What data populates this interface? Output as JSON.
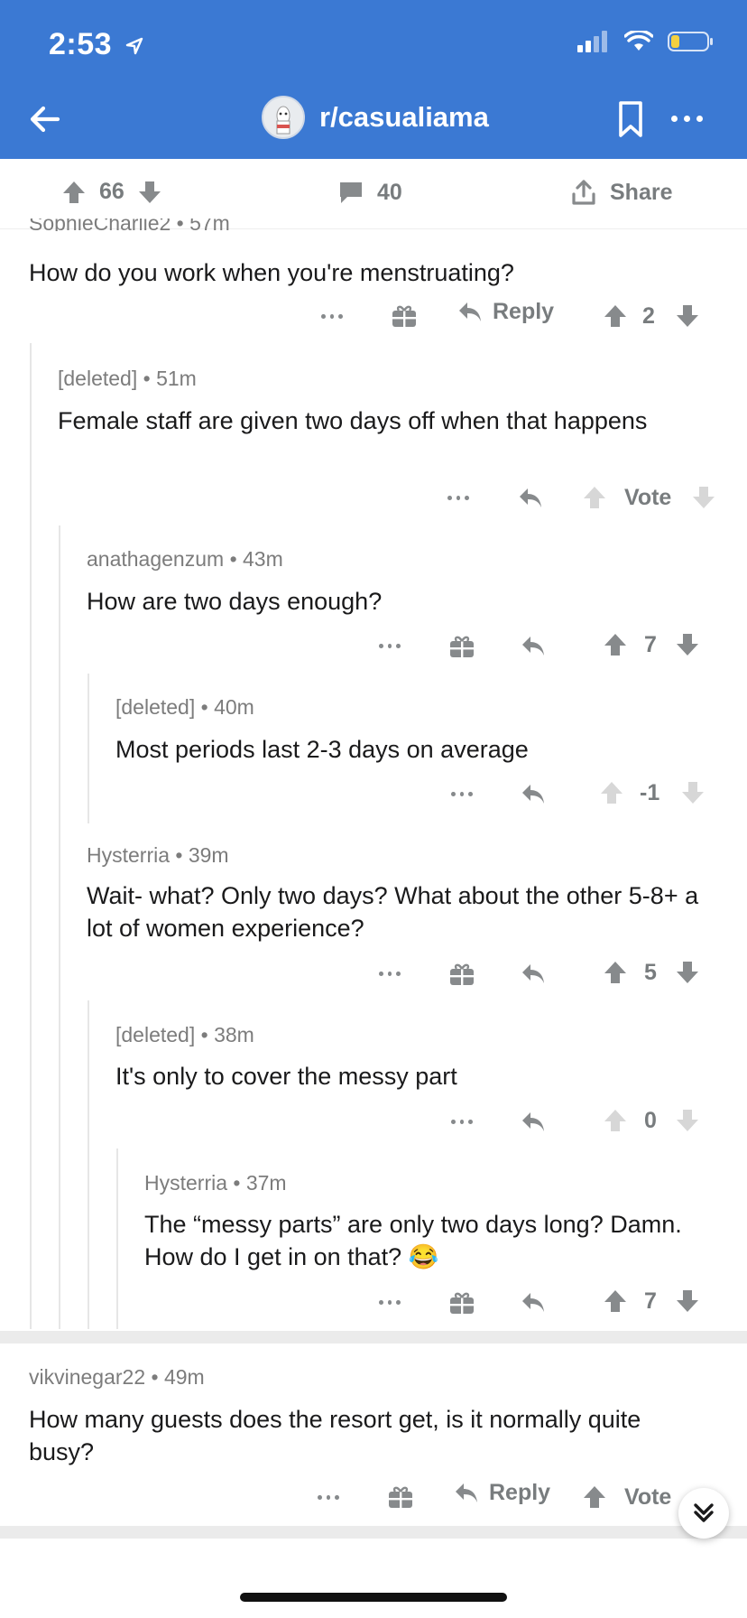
{
  "status": {
    "time": "2:53"
  },
  "nav": {
    "title": "r/casualiama"
  },
  "post_bar": {
    "score": "66",
    "comments": "40",
    "share": "Share"
  },
  "clipped_header": "SophieCharlie2 • 57m",
  "comments": [
    {
      "meta": "",
      "body": "How do you work when you're menstruating?",
      "reply": "Reply",
      "score": "2"
    },
    {
      "meta": "[deleted] • 51m",
      "body": "Female staff are given two days off when that happens",
      "score": "Vote"
    },
    {
      "meta": "anathagenzum • 43m",
      "body": "How are two days enough?",
      "score": "7"
    },
    {
      "meta": "[deleted] • 40m",
      "body": "Most periods last 2-3 days on average",
      "score": "-1"
    },
    {
      "meta": "Hysterria • 39m",
      "body": "Wait- what? Only two days? What about the other 5-8+ a lot of women experience?",
      "score": "5"
    },
    {
      "meta": "[deleted] • 38m",
      "body": "It's only to cover the messy part",
      "score": "0"
    },
    {
      "meta": "Hysterria • 37m",
      "body": "The “messy parts” are only two days long? Damn. How do I get in on that? 😂",
      "score": "7"
    },
    {
      "meta": "vikvinegar22 • 49m",
      "body": "How many guests does the resort get, is it normally quite busy?",
      "reply": "Reply",
      "score": "Vote"
    }
  ],
  "colors": {
    "brand": "#3b79d3",
    "vote_active": "#878a8c",
    "vote_inactive": "#d7d7d7"
  }
}
